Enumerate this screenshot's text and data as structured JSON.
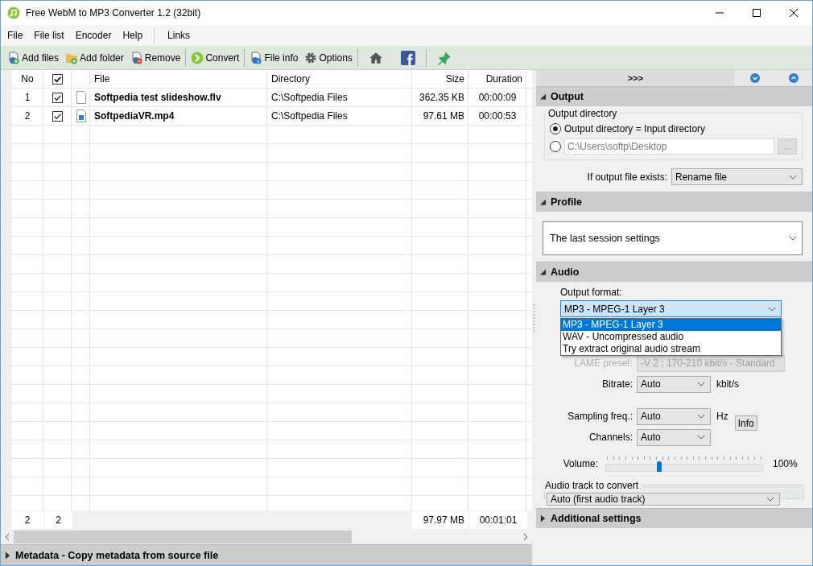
{
  "window": {
    "title": "Free WebM to MP3 Converter 1.2 (32bit)"
  },
  "menu": [
    "File",
    "File list",
    "Encoder",
    "Help"
  ],
  "links_menu": "Links",
  "toolbar_groups": [
    [
      {
        "label": "Add files",
        "kind": "add-files"
      },
      {
        "label": "Add folder",
        "kind": "add-folder"
      },
      {
        "label": "Remove",
        "kind": "remove"
      }
    ],
    [
      {
        "label": "Convert",
        "kind": "convert"
      }
    ],
    [
      {
        "label": "File info",
        "kind": "info"
      },
      {
        "label": "Options",
        "kind": "gear"
      }
    ],
    [
      {
        "kind": "home"
      },
      {
        "kind": "facebook"
      }
    ],
    [
      {
        "kind": "pin"
      }
    ]
  ],
  "table": {
    "columns": [
      "No",
      "File",
      "Directory",
      "Size",
      "Duration"
    ],
    "header_checked": true,
    "rows": [
      {
        "no": "1",
        "checked": true,
        "kind": "document",
        "file": "Softpedia test slideshow.flv",
        "directory": "C:\\Softpedia Files",
        "size": "362.35 KB",
        "duration": "00:00:09"
      },
      {
        "no": "2",
        "checked": true,
        "kind": "video",
        "file": "SoftpediaVR.mp4",
        "directory": "C:\\Softpedia Files",
        "size": "97.61 MB",
        "duration": "00:00:53"
      }
    ],
    "footer": {
      "count": "2",
      "checked_count": "2",
      "size": "97.97 MB",
      "duration": "00:01:01"
    }
  },
  "metadata": {
    "title": "Metadata - Copy metadata from source file",
    "expanded": false
  },
  "panel_toggle": ">>>",
  "output": {
    "title": "Output",
    "expanded": true,
    "group": "Output directory",
    "options": [
      {
        "label": "Output directory = Input directory",
        "selected": true
      },
      {
        "value": "C:\\Users\\softp\\Desktop",
        "selected": false
      }
    ],
    "browse": "...",
    "exists_label": "If output file exists:",
    "exists_value": "Rename file"
  },
  "profile": {
    "title": "Profile",
    "expanded": true,
    "value": "The last session settings"
  },
  "audio": {
    "title": "Audio",
    "expanded": true,
    "format_label": "Output format:",
    "format_value": "MP3 - MPEG-1 Layer 3",
    "format_options": [
      {
        "label": "MP3 - MPEG-1 Layer 3",
        "selected": true
      },
      {
        "label": "WAV - Uncompressed audio",
        "selected": false
      },
      {
        "label": "Try extract original audio stream",
        "selected": false
      }
    ],
    "lame_label": "LAME preset:",
    "lame_value": "-V 2 : 170-210 kbit/s - Standard",
    "bitrate_label": "Bitrate:",
    "bitrate_value": "Auto",
    "bitrate_unit": "kbit/s",
    "sampling_label": "Sampling freq.:",
    "sampling_value": "Auto",
    "sampling_unit": "Hz",
    "channels_label": "Channels:",
    "channels_value": "Auto",
    "info_button": "Info",
    "volume_label": "Volume:",
    "volume": {
      "level": 0.34
    },
    "volume_reading": "100%",
    "track_group": "Audio track to convert",
    "track_value": "Auto (first audio track)"
  },
  "additional": {
    "title": "Additional settings",
    "expanded": false
  }
}
